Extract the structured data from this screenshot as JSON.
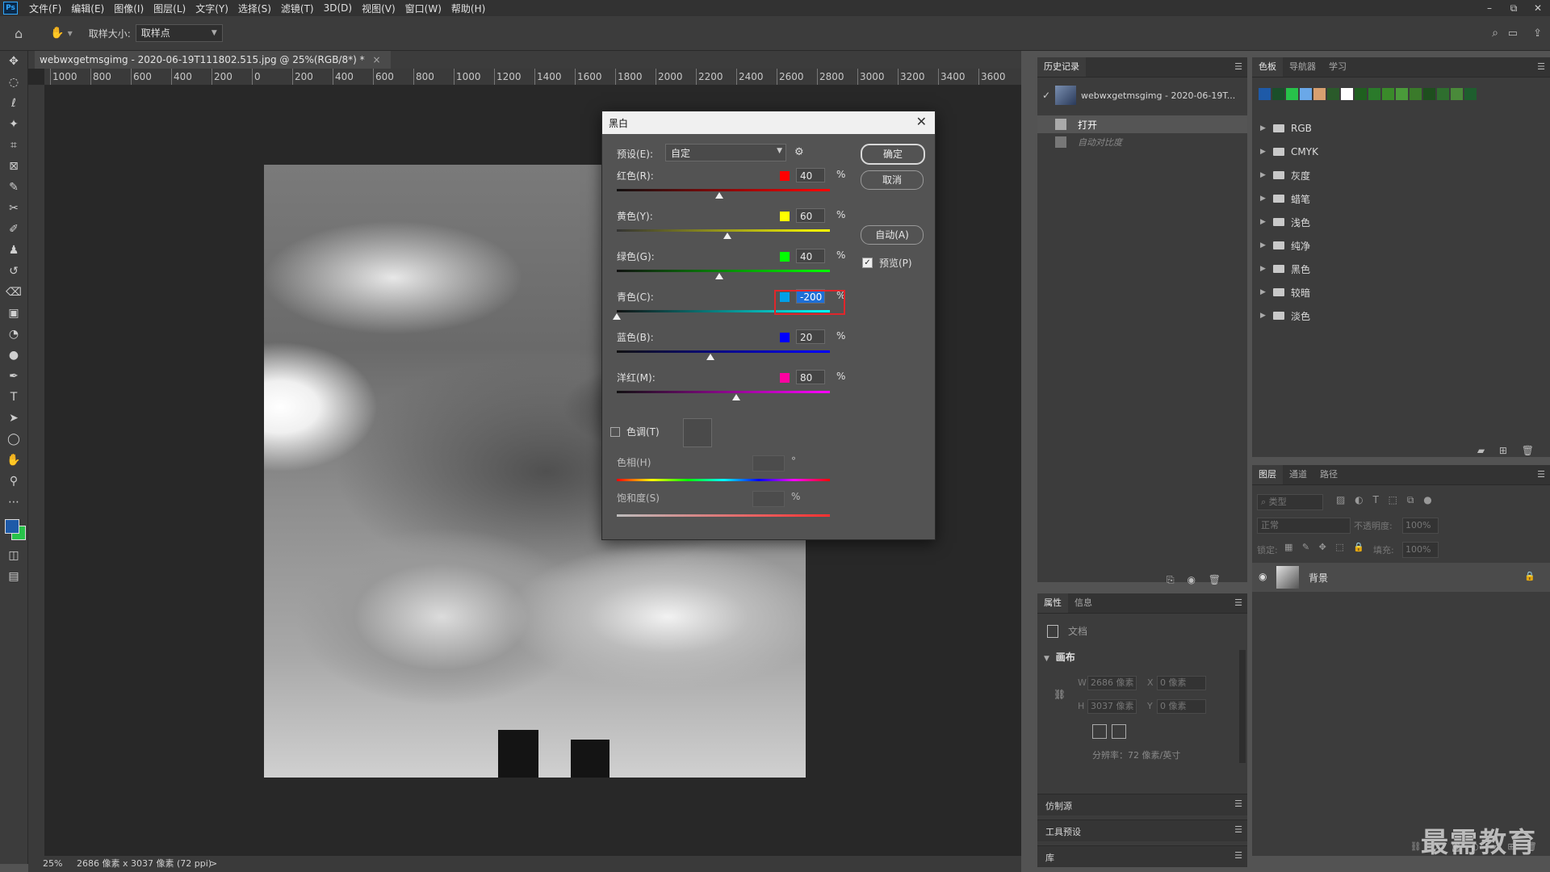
{
  "app": {
    "logo": "Ps"
  },
  "menu": [
    "文件(F)",
    "编辑(E)",
    "图像(I)",
    "图层(L)",
    "文字(Y)",
    "选择(S)",
    "滤镜(T)",
    "3D(D)",
    "视图(V)",
    "窗口(W)",
    "帮助(H)"
  ],
  "window_controls": [
    "–",
    "⧉",
    "✕"
  ],
  "options_bar": {
    "sample_label": "取样大小:",
    "sample_value": "取样点"
  },
  "document": {
    "tab_title": "webwxgetmsgimg - 2020-06-19T111802.515.jpg @ 25%(RGB/8*) *",
    "tab_close": "×",
    "ruler_marks": [
      "1000",
      "800",
      "600",
      "400",
      "200",
      "0",
      "200",
      "400",
      "600",
      "800",
      "1000",
      "1200",
      "1400",
      "1600",
      "1800",
      "2000",
      "2200",
      "2400",
      "2600",
      "2800",
      "3000",
      "3200",
      "3400",
      "3600"
    ]
  },
  "status": {
    "zoom": "25%",
    "info": "2686 像素 x 3037 像素 (72 ppi)",
    "arrow": ">"
  },
  "history_panel": {
    "tab": "历史记录",
    "snapshot": "webwxgetmsgimg - 2020-06-19T...",
    "steps": [
      "打开",
      "自动对比度"
    ]
  },
  "swatch_panel": {
    "tabs": [
      "色板",
      "导航器",
      "学习"
    ],
    "colors": [
      "#1e5aa8",
      "#1a4f2a",
      "#27c24a",
      "#6aa8e8",
      "#d8a070",
      "#2a5a2a",
      "#ffffff",
      "#1f5f1f",
      "#2a7a2a",
      "#3a8a2a",
      "#4a9a3a",
      "#3a7a2a",
      "#1e4e1e",
      "#2e6e2e",
      "#4a8a3a",
      "#1e5e2e"
    ],
    "groups": [
      "RGB",
      "CMYK",
      "灰度",
      "蜡笔",
      "浅色",
      "纯净",
      "黑色",
      "较暗",
      "淡色"
    ]
  },
  "layers_panel": {
    "tabs": [
      "图层",
      "通道",
      "路径"
    ],
    "search_placeholder": "类型",
    "blend_mode": "正常",
    "opacity_label": "不透明度:",
    "opacity_value": "100%",
    "lock_label": "锁定:",
    "fill_label": "填充:",
    "fill_value": "100%",
    "layer_name": "背景"
  },
  "properties_panel": {
    "tabs": [
      "属性",
      "信息"
    ],
    "doc_label": "文档",
    "section": "画布",
    "w_label": "W",
    "w_value": "2686 像素",
    "h_label": "H",
    "h_value": "3037 像素",
    "x_label": "X",
    "x_value": "0 像素",
    "y_label": "Y",
    "y_value": "0 像素",
    "resolution": "分辨率：72 像素/英寸"
  },
  "collapsed_panels": [
    "仿制源",
    "工具预设",
    "库"
  ],
  "dialog": {
    "title": "黑白",
    "preset_label": "预设(E):",
    "preset_value": "自定",
    "ok": "确定",
    "cancel": "取消",
    "auto": "自动(A)",
    "preview_label": "预览(P)",
    "preview_checked": true,
    "tint_label": "色调(T)",
    "tint_checked": false,
    "hue_label": "色相(H)",
    "hue_unit": "°",
    "sat_label": "饱和度(S)",
    "sat_unit": "%",
    "percent": "%",
    "sliders": [
      {
        "label": "红色(R):",
        "value": "40",
        "color": "#ff0000"
      },
      {
        "label": "黄色(Y):",
        "value": "60",
        "color": "#ffff00"
      },
      {
        "label": "绿色(G):",
        "value": "40",
        "color": "#00ff00"
      },
      {
        "label": "青色(C):",
        "value": "-200",
        "color": "#00a0e8"
      },
      {
        "label": "蓝色(B):",
        "value": "20",
        "color": "#0000ff"
      },
      {
        "label": "洋红(M):",
        "value": "80",
        "color": "#ff00a0"
      }
    ],
    "highlight_color": "#e1262b"
  },
  "watermark": "最需教育"
}
